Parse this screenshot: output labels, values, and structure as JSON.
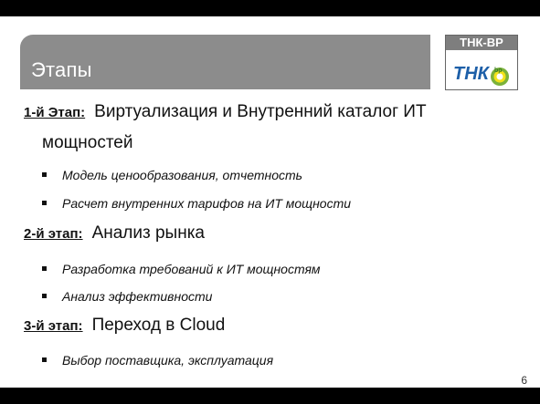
{
  "slide": {
    "title": "Этапы",
    "logo_text": "ТНК-ВР",
    "logo_mark_text": "ТНК",
    "bp_text": "bp",
    "page_number": "6"
  },
  "stages": [
    {
      "label": "1-й Этап:",
      "heading": "Виртуализация и Внутренний каталог ИТ",
      "heading_continued": "мощностей",
      "bullets": [
        "Модель ценообразования, отчетность",
        "Расчет внутренних тарифов на ИТ мощности"
      ]
    },
    {
      "label": "2-й этап:",
      "heading": "Анализ рынка",
      "bullets": [
        "Разработка требований к ИТ мощностям",
        "Анализ эффективности"
      ]
    },
    {
      "label": "3-й этап:",
      "heading": "Переход в Cloud",
      "bullets": [
        "Выбор поставщика, эксплуатация"
      ]
    }
  ]
}
